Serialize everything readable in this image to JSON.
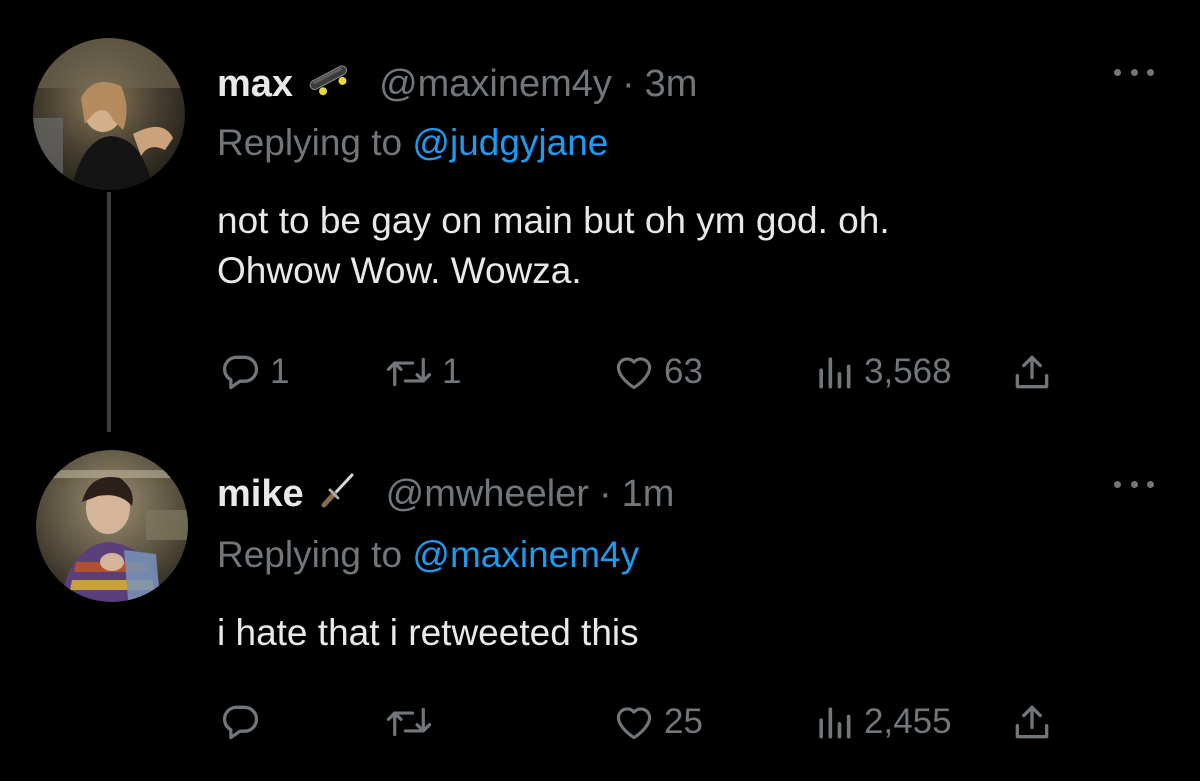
{
  "colors": {
    "background": "#000000",
    "primary_text": "#e7e9ea",
    "secondary_text": "#71767b",
    "link": "#1d9bf0"
  },
  "tweets": [
    {
      "display_name": "max",
      "badge_icon": "skateboard-icon",
      "handle": "@maxinem4y",
      "separator": "·",
      "time": "3m",
      "replying_prefix": "Replying to",
      "replying_to": "@judgyjane",
      "text_lines": [
        "not to be gay on main but oh ym god. oh.",
        "Ohwow Wow. Wowza."
      ],
      "replies": "1",
      "retweets": "1",
      "likes": "63",
      "views": "3,568"
    },
    {
      "display_name": "mike",
      "badge_icon": "dagger-icon",
      "handle": "@mwheeler",
      "separator": "·",
      "time": "1m",
      "replying_prefix": "Replying to",
      "replying_to": "@maxinem4y",
      "text_lines": [
        "i hate that i retweeted this"
      ],
      "replies": "",
      "retweets": "",
      "likes": "25",
      "views": "2,455"
    }
  ]
}
